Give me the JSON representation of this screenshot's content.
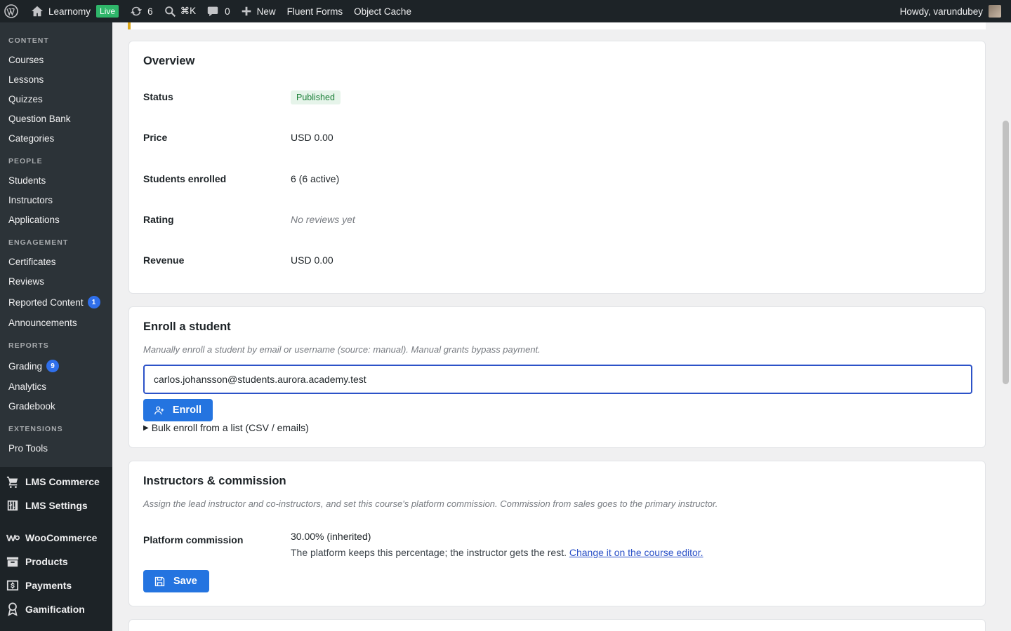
{
  "adminbar": {
    "site_name": "Learnomy",
    "live_label": "Live",
    "updates_count": "6",
    "search_shortcut": "⌘K",
    "comments_count": "0",
    "new_label": "New",
    "fluent_forms": "Fluent Forms",
    "object_cache": "Object Cache",
    "howdy": "Howdy, varundubey"
  },
  "sidebar": {
    "sections": [
      {
        "heading": "CONTENT",
        "items": [
          "Courses",
          "Lessons",
          "Quizzes",
          "Question Bank",
          "Categories"
        ]
      },
      {
        "heading": "PEOPLE",
        "items": [
          "Students",
          "Instructors",
          "Applications"
        ]
      },
      {
        "heading": "ENGAGEMENT",
        "items": [
          "Certificates",
          "Reviews",
          "Reported Content",
          "Announcements"
        ]
      },
      {
        "heading": "REPORTS",
        "items": [
          "Grading",
          "Analytics",
          "Gradebook"
        ]
      },
      {
        "heading": "EXTENSIONS",
        "items": [
          "Pro Tools"
        ]
      }
    ],
    "reported_count": "1",
    "grading_count": "9",
    "top_items": [
      "LMS Commerce",
      "LMS Settings",
      "WooCommerce",
      "Products",
      "Payments",
      "Gamification"
    ]
  },
  "overview": {
    "title": "Overview",
    "rows": [
      {
        "label": "Status",
        "value": "Published"
      },
      {
        "label": "Price",
        "value": "USD 0.00"
      },
      {
        "label": "Students enrolled",
        "value": "6 (6 active)"
      },
      {
        "label": "Rating",
        "value": "No reviews yet"
      },
      {
        "label": "Revenue",
        "value": "USD 0.00"
      }
    ]
  },
  "enroll": {
    "title": "Enroll a student",
    "hint": "Manually enroll a student by email or username (source: manual). Manual grants bypass payment.",
    "input_value": "carlos.johansson@students.aurora.academy.test",
    "button_label": "Enroll",
    "bulk_label": "Bulk enroll from a list (CSV / emails)"
  },
  "instructors": {
    "title": "Instructors & commission",
    "hint": "Assign the lead instructor and co-instructors, and set this course's platform commission. Commission from sales goes to the primary instructor.",
    "commission_label": "Platform commission",
    "commission_value": "30.00% (inherited)",
    "commission_note": "The platform keeps this percentage; the instructor gets the rest.",
    "commission_link": "Change it on the course editor.",
    "save_label": "Save"
  },
  "colors": {
    "adminbar_bg": "#1d2327",
    "primary_button": "#2474e0",
    "published_badge": "#1a7f37",
    "count_badge": "#2f6feb",
    "notice_border": "#dba617"
  }
}
